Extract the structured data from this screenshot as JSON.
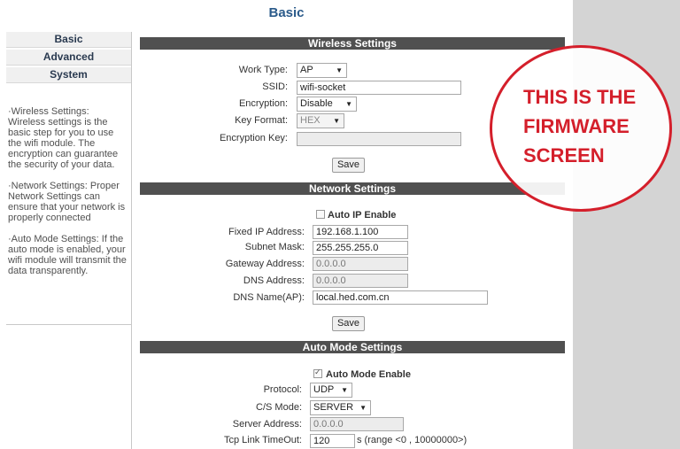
{
  "page_title": "Basic",
  "nav": [
    {
      "label": "Basic"
    },
    {
      "label": "Advanced"
    },
    {
      "label": "System"
    }
  ],
  "help": [
    "·Wireless Settings: Wireless settings is the basic step for you to use the wifi module. The encryption can guarantee the security of your data.",
    "·Network Settings: Proper Network Settings can ensure that your network is properly connected",
    "·Auto Mode Settings: If the auto mode is enabled, your wifi module will transmit the data transparently."
  ],
  "wireless": {
    "title": "Wireless Settings",
    "work_type_label": "Work Type:",
    "work_type_value": "AP",
    "ssid_label": "SSID:",
    "ssid_value": "wifi-socket",
    "encryption_label": "Encryption:",
    "encryption_value": "Disable",
    "key_format_label": "Key Format:",
    "key_format_value": "HEX",
    "encryption_key_label": "Encryption Key:",
    "encryption_key_value": "",
    "save_label": "Save"
  },
  "network": {
    "title": "Network Settings",
    "auto_ip_label": "Auto IP Enable",
    "auto_ip_checked": false,
    "fixed_ip_label": "Fixed IP Address:",
    "fixed_ip_value": "192.168.1.100",
    "subnet_label": "Subnet Mask:",
    "subnet_value": "255.255.255.0",
    "gateway_label": "Gateway Address:",
    "gateway_value": "0.0.0.0",
    "dns_label": "DNS Address:",
    "dns_value": "0.0.0.0",
    "dns_name_label": "DNS Name(AP):",
    "dns_name_value": "local.hed.com.cn",
    "save_label": "Save"
  },
  "auto_mode": {
    "title": "Auto Mode Settings",
    "enable_label": "Auto Mode Enable",
    "enable_checked": true,
    "protocol_label": "Protocol:",
    "protocol_value": "UDP",
    "cs_mode_label": "C/S Mode:",
    "cs_mode_value": "SERVER",
    "server_address_label": "Server Address:",
    "server_address_value": "0.0.0.0",
    "timeout_label": "Tcp Link TimeOut:",
    "timeout_value": "120",
    "timeout_hint": "s (range <0 , 10000000>)"
  },
  "annotation": {
    "lines": [
      "THIS IS THE",
      "FIRMWARE",
      "SCREEN"
    ],
    "color": "#d41f2b"
  }
}
